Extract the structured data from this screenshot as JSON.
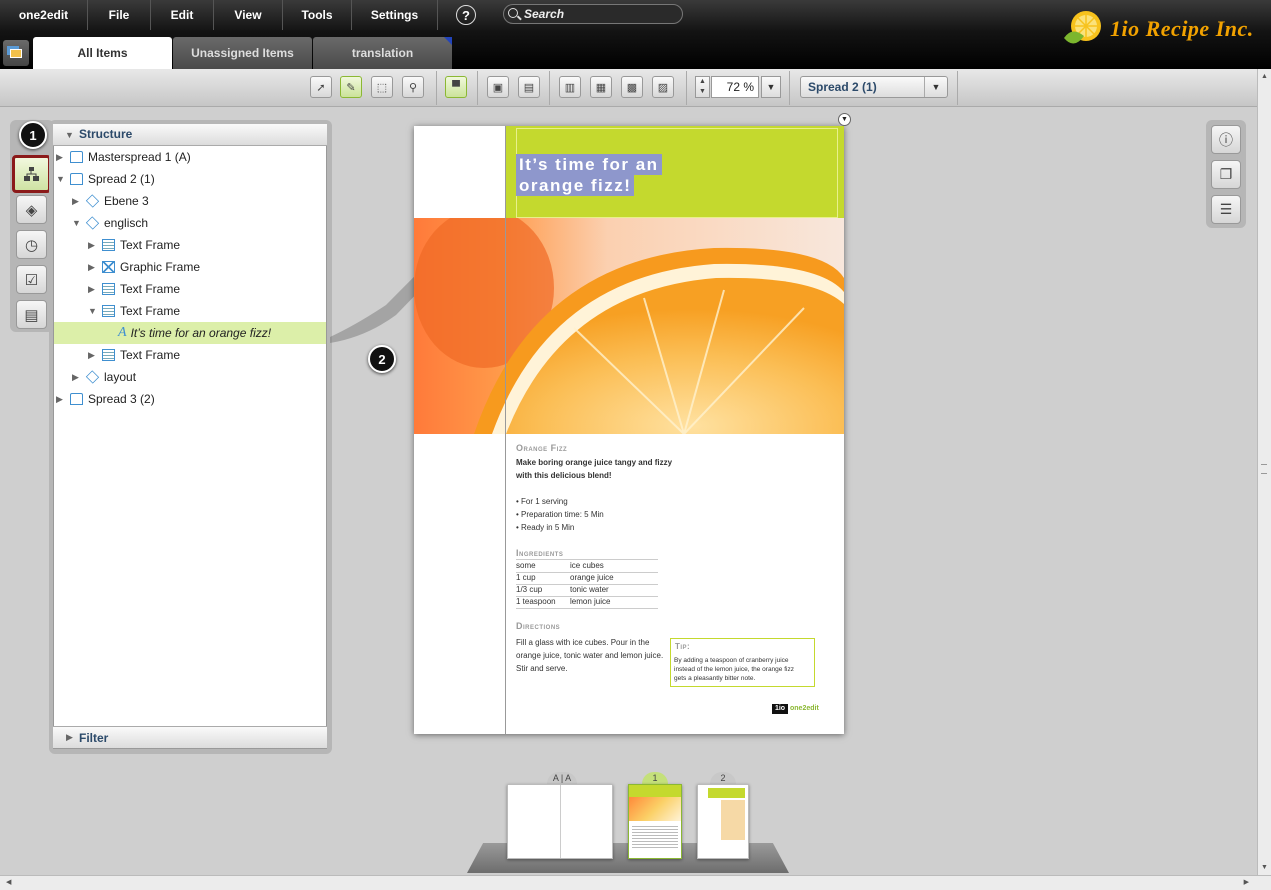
{
  "menu": {
    "items": [
      "one2edit",
      "File",
      "Edit",
      "View",
      "Tools",
      "Settings"
    ],
    "help_label": "?",
    "search_placeholder": "Search"
  },
  "logo": {
    "text": "1io Recipe Inc."
  },
  "tabs": [
    {
      "label": "All Items",
      "active": true
    },
    {
      "label": "Unassigned Items",
      "active": false
    },
    {
      "label": "translation",
      "active": false
    }
  ],
  "toolbar": {
    "zoom": "72 %",
    "spread_select": "Spread 2 (1)"
  },
  "structure": {
    "title": "Structure",
    "filter_label": "Filter",
    "tree": [
      {
        "label": "Masterspread 1 (A)",
        "icon": "page-icon",
        "arrow": "▶"
      },
      {
        "label": "Spread 2 (1)",
        "icon": "page-icon",
        "arrow": "▼"
      },
      {
        "label": "Ebene 3",
        "icon": "layer-icon",
        "arrow": "▶"
      },
      {
        "label": "englisch",
        "icon": "layer-icon",
        "arrow": "▼"
      },
      {
        "label": "Text Frame",
        "icon": "text-frame-icon",
        "arrow": "▶"
      },
      {
        "label": "Graphic Frame",
        "icon": "graphic-frame-icon",
        "arrow": "▶"
      },
      {
        "label": "Text Frame",
        "icon": "text-frame-icon",
        "arrow": "▶"
      },
      {
        "label": "Text Frame",
        "icon": "text-frame-icon",
        "arrow": "▼"
      },
      {
        "label": "It’s time for an  orange fizz!",
        "icon": "text-content-icon",
        "arrow": ""
      },
      {
        "label": "Text Frame",
        "icon": "text-frame-icon",
        "arrow": "▶"
      },
      {
        "label": "layout",
        "icon": "layer-icon",
        "arrow": "▶"
      },
      {
        "label": "Spread 3 (2)",
        "icon": "page-icon",
        "arrow": "▶"
      }
    ]
  },
  "callouts": [
    "1",
    "2"
  ],
  "document": {
    "title_lines": [
      "It’s time for an",
      "orange fizz!"
    ],
    "recipe_title": "Orange Fizz",
    "intro_lines": [
      "Make boring orange juice tangy and fizzy",
      "with this delicious blend!"
    ],
    "bullets": [
      "• For 1 serving",
      "• Preparation time: 5 Min",
      "• Ready in 5 Min"
    ],
    "ingredients_head": "Ingredients",
    "ingredients": [
      {
        "qty": "some",
        "item": "ice cubes"
      },
      {
        "qty": "1 cup",
        "item": "orange juice"
      },
      {
        "qty": "1/3 cup",
        "item": "tonic water"
      },
      {
        "qty": "1 teaspoon",
        "item": "lemon juice"
      }
    ],
    "directions_head": "Directions",
    "directions_lines": [
      "Fill a glass with ice cubes. Pour in the",
      "orange juice, tonic water and lemon juice.",
      "Stir and serve."
    ],
    "tip_head": "Tip:",
    "tip_lines": [
      "By adding a teaspoon of cranberry juice",
      "instead of the lemon juice, the orange fizz",
      "gets a pleasantly bitter note."
    ],
    "footer_logo": "one2edit"
  },
  "thumbnails": [
    {
      "label": "A | A"
    },
    {
      "label": "1"
    },
    {
      "label": "2"
    }
  ],
  "colors": {
    "accent_green": "#c4d92e",
    "highlight": "#8e97cc",
    "brand_orange": "#f2a200",
    "selection_red": "#8b1a1a"
  }
}
